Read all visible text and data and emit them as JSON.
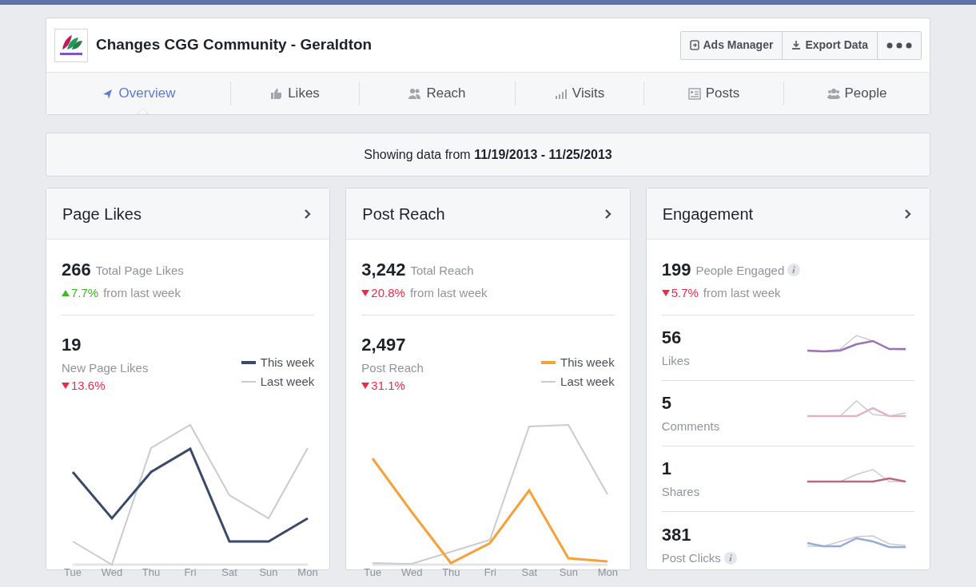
{
  "page": {
    "title": "Changes CGG Community - Geraldton"
  },
  "actions": [
    {
      "label": "Ads Manager",
      "kind": "ads"
    },
    {
      "label": "Export Data",
      "kind": "export"
    },
    {
      "kind": "more"
    }
  ],
  "tabs": [
    {
      "label": "Overview",
      "kind": "overview",
      "selected": true
    },
    {
      "label": "Likes",
      "kind": "likes",
      "selected": false
    },
    {
      "label": "Reach",
      "kind": "reach",
      "selected": false
    },
    {
      "label": "Visits",
      "kind": "visits",
      "selected": false
    },
    {
      "label": "Posts",
      "kind": "posts",
      "selected": false
    },
    {
      "label": "People",
      "kind": "people",
      "selected": false
    }
  ],
  "date_range": {
    "prefix": "Showing data from",
    "range": "11/19/2013 - 11/25/2013"
  },
  "cards": [
    {
      "title": "Page Likes",
      "kind": "chart",
      "total": {
        "value": "266",
        "label": "Total Page Likes"
      },
      "trend": {
        "kind": "up",
        "value": "7.7%",
        "text": "from last week"
      },
      "detail": {
        "value": "19",
        "label": "New Page Likes",
        "trend": {
          "kind": "down",
          "value": "13.6%"
        }
      },
      "legend": [
        {
          "label": "This week",
          "color": "#3b4a6b"
        },
        {
          "label": "Last week",
          "color": "#c9cbd0"
        }
      ],
      "days": [
        "Tue",
        "Wed",
        "Thu",
        "Fri",
        "Sat",
        "Sun",
        "Mon"
      ]
    },
    {
      "title": "Post Reach",
      "kind": "chart",
      "total": {
        "value": "3,242",
        "label": "Total Reach"
      },
      "trend": {
        "kind": "down",
        "value": "20.8%",
        "text": "from last week"
      },
      "detail": {
        "value": "2,497",
        "label": "Post Reach",
        "trend": {
          "kind": "down",
          "value": "31.1%"
        }
      },
      "legend": [
        {
          "label": "This week",
          "color": "#f7a13b"
        },
        {
          "label": "Last week",
          "color": "#c9cbd0"
        }
      ],
      "days": [
        "Tue",
        "Wed",
        "Thu",
        "Fri",
        "Sat",
        "Sun",
        "Mon"
      ]
    },
    {
      "title": "Engagement",
      "kind": "list",
      "total": {
        "value": "199",
        "label": "People Engaged",
        "info": true
      },
      "trend": {
        "kind": "down",
        "value": "5.7%",
        "text": "from last week"
      },
      "rows": [
        {
          "value": "56",
          "label": "Likes",
          "color": "#9b72b8"
        },
        {
          "value": "5",
          "label": "Comments",
          "color": "#e2b3c6"
        },
        {
          "value": "1",
          "label": "Shares",
          "color": "#b86a85"
        },
        {
          "value": "381",
          "label": "Post Clicks",
          "color": "#94acd6",
          "info": true
        }
      ]
    }
  ]
}
